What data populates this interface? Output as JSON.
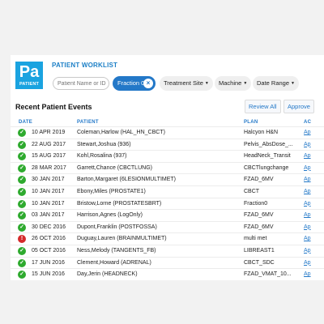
{
  "logo": {
    "letters": "Pa",
    "sub": "PATIENT"
  },
  "header": {
    "title": "PATIENT WORKLIST"
  },
  "search": {
    "placeholder": "Patient Name or ID"
  },
  "filters": {
    "active_chip": "Fraction 0",
    "treatment_site": "Treatment Site",
    "machine": "Machine",
    "date_range": "Date Range"
  },
  "events": {
    "title": "Recent Patient Events",
    "review_all": "Review All",
    "approve": "Approve",
    "columns": {
      "date": "DATE",
      "patient": "PATIENT",
      "plan": "PLAN",
      "action": "AC"
    },
    "rows": [
      {
        "status": "ok",
        "date": "10 APR 2019",
        "patient": "Coleman,Harlow (HAL_HN_CBCT)",
        "plan": "Halcyon H&N",
        "action": "Ap"
      },
      {
        "status": "ok",
        "date": "22 AUG 2017",
        "patient": "Stewart,Joshua (936)",
        "plan": "Pelvis_AbsDose_...",
        "action": "Ap"
      },
      {
        "status": "ok",
        "date": "15 AUG 2017",
        "patient": "Kohl,Rosalina (937)",
        "plan": "HeadNeck_Transit",
        "action": "Ap"
      },
      {
        "status": "ok",
        "date": "28 MAR 2017",
        "patient": "Garrett,Chance (CBCTLUNG)",
        "plan": "CBCTlungchange",
        "action": "Ap"
      },
      {
        "status": "ok",
        "date": "30 JAN 2017",
        "patient": "Barton,Margaret (6LESIONMULTIMET)",
        "plan": "FZAD_6MV",
        "action": "Ap"
      },
      {
        "status": "ok",
        "date": "10 JAN 2017",
        "patient": "Ebony,Miles (PROSTATE1)",
        "plan": "CBCT",
        "action": "Ap"
      },
      {
        "status": "ok",
        "date": "10 JAN 2017",
        "patient": "Bristow,Lorne (PROSTATESBRT)",
        "plan": "Fraction0",
        "action": "Ap"
      },
      {
        "status": "ok",
        "date": "03 JAN 2017",
        "patient": "Harrison,Agnes (LogOnly)",
        "plan": "FZAD_6MV",
        "action": "Ap"
      },
      {
        "status": "ok",
        "date": "30 DEC 2016",
        "patient": "Dupont,Franklin (POSTFOSSA)",
        "plan": "FZAD_6MV",
        "action": "Ap"
      },
      {
        "status": "error",
        "date": "26 OCT 2016",
        "patient": "Duguay,Lauren (BRAINMULTIMET)",
        "plan": "multi met",
        "action": "Ap"
      },
      {
        "status": "ok",
        "date": "05 OCT 2016",
        "patient": "Ness,Melody (TANGENTS_FB)",
        "plan": "LIBREAST1",
        "action": "Ap"
      },
      {
        "status": "ok",
        "date": "17 JUN 2016",
        "patient": "Clement,Howard (ADRENAL)",
        "plan": "CBCT_SDC",
        "action": "Ap"
      },
      {
        "status": "ok",
        "date": "15 JUN 2016",
        "patient": "Day,Jerin (HEADNECK)",
        "plan": "FZAD_VMAT_10...",
        "action": "Ap"
      }
    ]
  },
  "colors": {
    "accent": "#2378c8",
    "logo": "#1aa3e0",
    "ok": "#2eaa2e",
    "error": "#d52a2a"
  },
  "icons": {
    "ok": "check-circle-icon",
    "error": "alert-circle-icon",
    "remove": "close-icon",
    "caret": "chevron-down-icon"
  }
}
